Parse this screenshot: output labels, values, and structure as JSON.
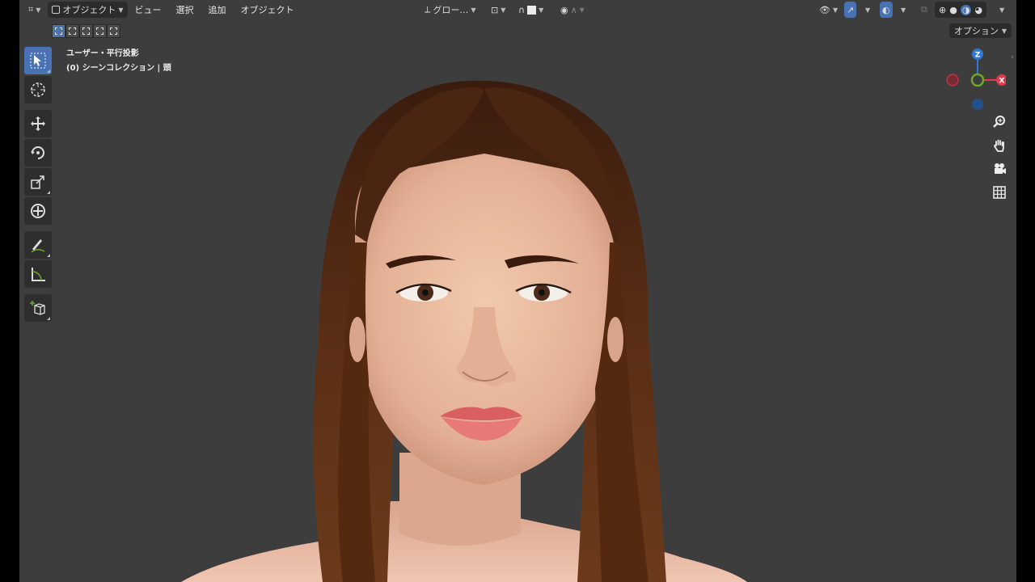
{
  "header": {
    "mode_label": "オブジェクト",
    "menus": [
      "ビュー",
      "選択",
      "追加",
      "オブジェクト"
    ],
    "transform_orientation": "グロー…",
    "options_label": "オプション"
  },
  "viewport_info": {
    "view_name": "ユーザー・平行投影",
    "collection_label": "(0) シーンコレクション | 頭"
  },
  "gizmo": {
    "z_label": "Z",
    "x_label": "X"
  },
  "colors": {
    "viewport_bg": "#3d3d3d",
    "accent_blue": "#4772b3",
    "axis_x": "#e0394b",
    "axis_y": "#6ea72c",
    "axis_z": "#2f78d6",
    "hair": "#4a2512",
    "lips": "#d96a6a"
  },
  "toolbar_icons": [
    "select-box-icon",
    "cursor-icon",
    "move-icon",
    "rotate-icon",
    "scale-icon",
    "transform-icon",
    "annotate-icon",
    "measure-icon",
    "add-cube-icon"
  ]
}
